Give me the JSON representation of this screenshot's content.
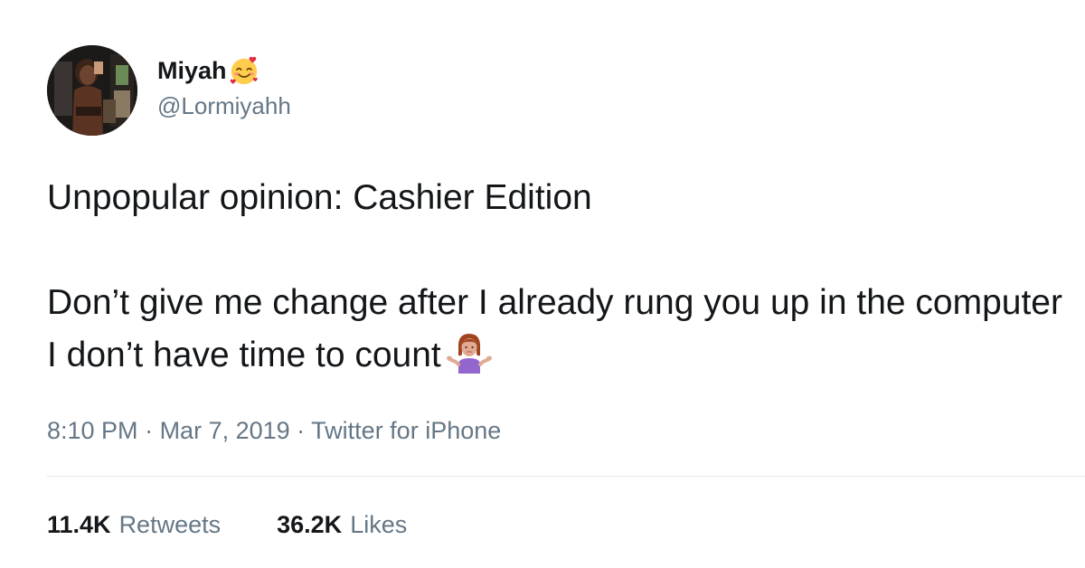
{
  "user": {
    "display_name": "Miyah",
    "name_emoji": "smiling-face-with-hearts-icon",
    "handle": "@Lormiyahh"
  },
  "tweet": {
    "line1": "Unpopular opinion: Cashier Edition",
    "line2": "Don’t give me change after I already rung you up in the computer I don’t have time to count",
    "trailing_emoji": "person-shrugging-icon"
  },
  "meta": {
    "time": "8:10 PM",
    "separator1": " · ",
    "date": "Mar 7, 2019",
    "separator2": " · ",
    "source": "Twitter for iPhone"
  },
  "stats": {
    "retweets_count": "11.4K",
    "retweets_label": "Retweets",
    "likes_count": "36.2K",
    "likes_label": "Likes"
  },
  "colors": {
    "text": "#14171a",
    "secondary": "#657786",
    "divider": "#e1e8ed"
  }
}
